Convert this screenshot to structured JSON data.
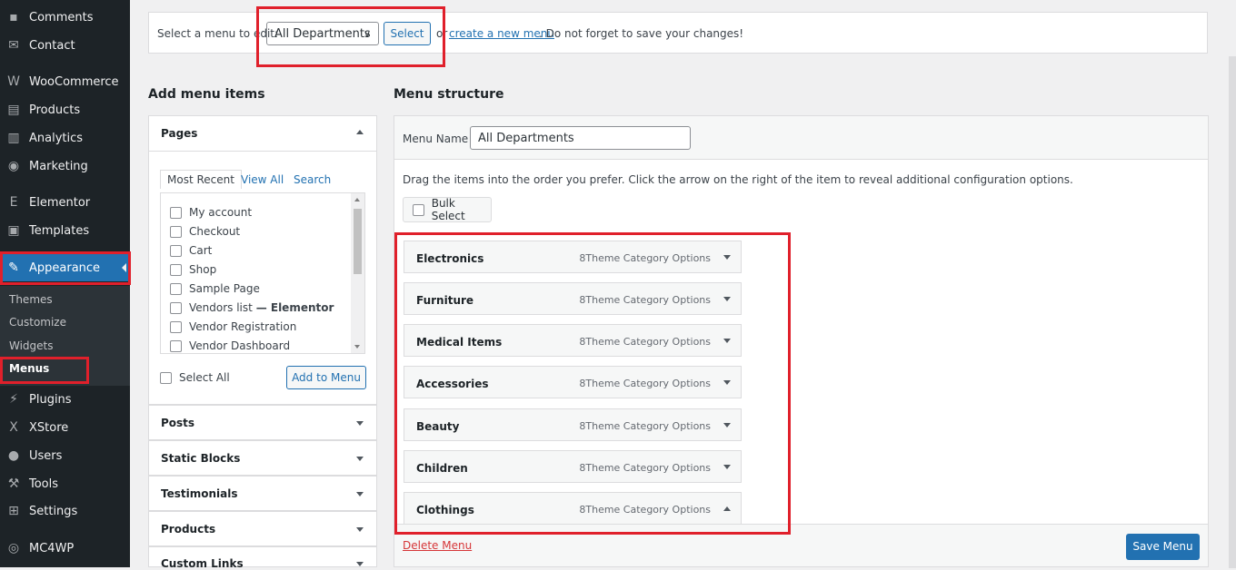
{
  "sidebar": {
    "items": [
      {
        "label": "Comments",
        "icon": "comment-icon",
        "glyph": "▪"
      },
      {
        "label": "Contact",
        "icon": "mail-icon",
        "glyph": "✉"
      },
      {
        "label": "WooCommerce",
        "icon": "woo-icon",
        "glyph": "W"
      },
      {
        "label": "Products",
        "icon": "archive-icon",
        "glyph": "▤"
      },
      {
        "label": "Analytics",
        "icon": "bar-chart-icon",
        "glyph": "▥"
      },
      {
        "label": "Marketing",
        "icon": "megaphone-icon",
        "glyph": "◉"
      },
      {
        "label": "Elementor",
        "icon": "elementor-icon",
        "glyph": "E"
      },
      {
        "label": "Templates",
        "icon": "folder-icon",
        "glyph": "▣"
      },
      {
        "label": "Appearance",
        "icon": "paintbrush-icon",
        "glyph": "✎"
      },
      {
        "label": "Plugins",
        "icon": "plug-icon",
        "glyph": "⚡"
      },
      {
        "label": "XStore",
        "icon": "xstore-icon",
        "glyph": "X"
      },
      {
        "label": "Users",
        "icon": "user-icon",
        "glyph": "●"
      },
      {
        "label": "Tools",
        "icon": "wrench-icon",
        "glyph": "⚒"
      },
      {
        "label": "Settings",
        "icon": "settings-icon",
        "glyph": "⊞"
      },
      {
        "label": "MC4WP",
        "icon": "mc4wp-icon",
        "glyph": "◎"
      }
    ],
    "submenu": [
      "Themes",
      "Customize",
      "Widgets",
      "Menus"
    ]
  },
  "topbar": {
    "label": "Select a menu to edit:",
    "selected": "All Departments",
    "select_button": "Select",
    "or": "or",
    "create_link": "create a new menu",
    "tail": ". Do not forget to save your changes!"
  },
  "left": {
    "heading": "Add menu items",
    "pages_title": "Pages",
    "tabs": [
      "Most Recent",
      "View All",
      "Search"
    ],
    "pages": [
      "My account",
      "Checkout",
      "Cart",
      "Shop",
      "Sample Page",
      "Vendors list",
      "Vendor Registration",
      "Vendor Dashboard"
    ],
    "vendors_suffix": "— Elementor",
    "select_all": "Select All",
    "add_button": "Add to Menu",
    "sections": [
      "Posts",
      "Static Blocks",
      "Testimonials",
      "Products",
      "Custom Links"
    ]
  },
  "right": {
    "heading": "Menu structure",
    "menu_name_label": "Menu Name",
    "menu_name_value": "All Departments",
    "instructions": "Drag the items into the order you prefer. Click the arrow on the right of the item to reveal additional configuration options.",
    "bulk_select": "Bulk Select",
    "item_option_label": "8Theme Category Options",
    "items": [
      "Electronics",
      "Furniture",
      "Medical Items",
      "Accessories",
      "Beauty",
      "Children",
      "Clothings"
    ],
    "delete_link": "Delete Menu",
    "save_button": "Save Menu"
  },
  "colors": {
    "accent": "#2271b1",
    "highlight": "#e0202b",
    "sidebar": "#1d2327"
  }
}
